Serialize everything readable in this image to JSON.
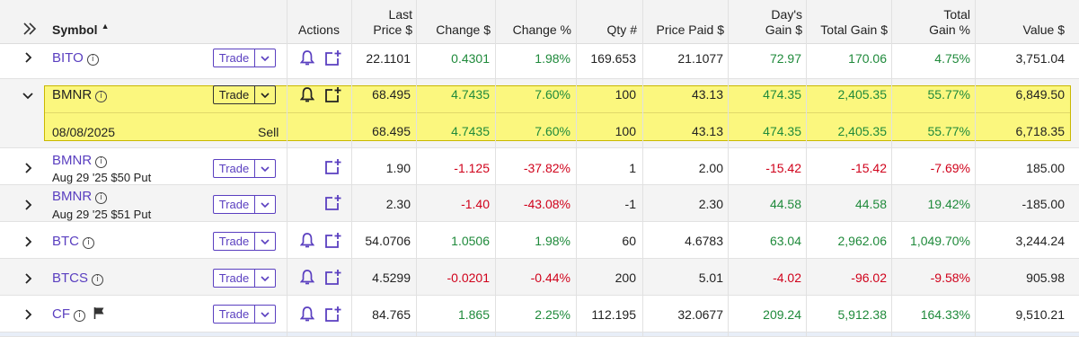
{
  "header": {
    "expand_all_icon": "double-chevron-right-icon",
    "symbol": "Symbol",
    "sort_icon": "▲",
    "actions": "Actions",
    "last_price_1": "Last",
    "last_price_2": "Price $",
    "change_dollar": "Change $",
    "change_pct": "Change %",
    "qty": "Qty #",
    "price_paid": "Price Paid $",
    "days_gain_1": "Day's",
    "days_gain_2": "Gain $",
    "total_gain_dollar": "Total Gain $",
    "total_gain_pct_1": "Total",
    "total_gain_pct_2": "Gain %",
    "value": "Value $"
  },
  "trade_label": "Trade",
  "rows": [
    {
      "symbol": "BITO",
      "sub": "",
      "last": "22.1101",
      "chg": "0.4301",
      "chgp": "1.98%",
      "qty": "169.653",
      "paid": "21.1077",
      "day": "72.97",
      "tg": "170.06",
      "tgp": "4.75%",
      "val": "3,751.04"
    },
    {
      "symbol": "BMNR",
      "sub": "",
      "last": "68.495",
      "chg": "4.7435",
      "chgp": "7.60%",
      "qty": "100",
      "paid": "43.13",
      "day": "474.35",
      "tg": "2,405.35",
      "tgp": "55.77%",
      "val": "6,849.50"
    },
    {
      "date": "08/08/2025",
      "action": "Sell",
      "last": "68.495",
      "chg": "4.7435",
      "chgp": "7.60%",
      "qty": "100",
      "paid": "43.13",
      "day": "474.35",
      "tg": "2,405.35",
      "tgp": "55.77%",
      "val": "6,718.35"
    },
    {
      "symbol": "BMNR",
      "sub": "Aug 29 '25 $50 Put",
      "last": "1.90",
      "chg": "-1.125",
      "chgp": "-37.82%",
      "qty": "1",
      "paid": "2.00",
      "day": "-15.42",
      "tg": "-15.42",
      "tgp": "-7.69%",
      "val": "185.00"
    },
    {
      "symbol": "BMNR",
      "sub": "Aug 29 '25 $51 Put",
      "last": "2.30",
      "chg": "-1.40",
      "chgp": "-43.08%",
      "qty": "-1",
      "paid": "2.30",
      "day": "44.58",
      "tg": "44.58",
      "tgp": "19.42%",
      "val": "-185.00"
    },
    {
      "symbol": "BTC",
      "sub": "",
      "last": "54.0706",
      "chg": "1.0506",
      "chgp": "1.98%",
      "qty": "60",
      "paid": "4.6783",
      "day": "63.04",
      "tg": "2,962.06",
      "tgp": "1,049.70%",
      "val": "3,244.24"
    },
    {
      "symbol": "BTCS",
      "sub": "",
      "last": "4.5299",
      "chg": "-0.0201",
      "chgp": "-0.44%",
      "qty": "200",
      "paid": "5.01",
      "day": "-4.02",
      "tg": "-96.02",
      "tgp": "-9.58%",
      "val": "905.98"
    },
    {
      "symbol": "CF",
      "sub": "",
      "last": "84.765",
      "chg": "1.865",
      "chgp": "2.25%",
      "qty": "112.195",
      "paid": "32.0677",
      "day": "209.24",
      "tg": "5,912.38",
      "tgp": "164.33%",
      "val": "9,510.21"
    }
  ],
  "colors": {
    "positive": "#1f8a3b",
    "negative": "#d0021b",
    "link": "#5a3fc0",
    "highlight": "#fbf77e"
  }
}
